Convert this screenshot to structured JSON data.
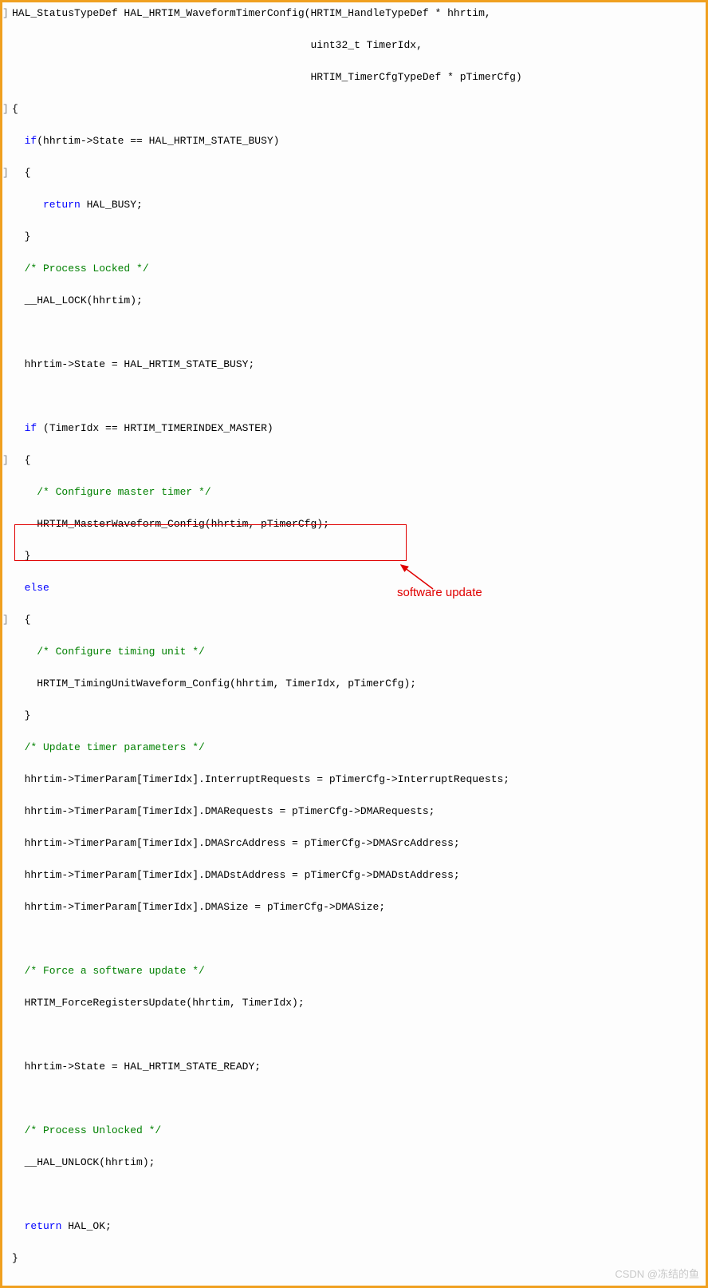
{
  "code": {
    "l1a": "HAL_StatusTypeDef HAL_HRTIM_WaveformTimerConfig(HRTIM_HandleTypeDef * hhrtim,",
    "l1b": "                                                uint32_t TimerIdx,",
    "l1c": "                                                HRTIM_TimerCfgTypeDef * pTimerCfg)",
    "l2": "{",
    "l3a": "  if",
    "l3b": "(hhrtim->State == HAL_HRTIM_STATE_BUSY)",
    "l4": "  {",
    "l5a": "     return",
    "l5b": " HAL_BUSY;",
    "l6": "  }",
    "l7": "  /* Process Locked */",
    "l8": "  __HAL_LOCK(hhrtim);",
    "l9": "",
    "l10": "  hhrtim->State = HAL_HRTIM_STATE_BUSY;",
    "l11": "",
    "l12a": "  if",
    "l12b": " (TimerIdx == HRTIM_TIMERINDEX_MASTER)",
    "l13": "  {",
    "l14": "    /* Configure master timer */",
    "l15": "    HRTIM_MasterWaveform_Config(hhrtim, pTimerCfg);",
    "l16": "  }",
    "l17": "  else",
    "l18": "  {",
    "l19": "    /* Configure timing unit */",
    "l20": "    HRTIM_TimingUnitWaveform_Config(hhrtim, TimerIdx, pTimerCfg);",
    "l21": "  }",
    "l22": "  /* Update timer parameters */",
    "l23": "  hhrtim->TimerParam[TimerIdx].InterruptRequests = pTimerCfg->InterruptRequests;",
    "l24": "  hhrtim->TimerParam[TimerIdx].DMARequests = pTimerCfg->DMARequests;",
    "l25": "  hhrtim->TimerParam[TimerIdx].DMASrcAddress = pTimerCfg->DMASrcAddress;",
    "l26": "  hhrtim->TimerParam[TimerIdx].DMADstAddress = pTimerCfg->DMADstAddress;",
    "l27": "  hhrtim->TimerParam[TimerIdx].DMASize = pTimerCfg->DMASize;",
    "l28": "",
    "l29": "  /* Force a software update */",
    "l30": "  HRTIM_ForceRegistersUpdate(hhrtim, TimerIdx);",
    "l31": "",
    "l32": "  hhrtim->State = HAL_HRTIM_STATE_READY;",
    "l33": "",
    "l34": "  /* Process Unlocked */",
    "l35": "  __HAL_UNLOCK(hhrtim);",
    "l36": "",
    "l37a": "  return",
    "l37b": " HAL_OK;",
    "l38": "}"
  },
  "fold": {
    "close": "]",
    "open": "]"
  },
  "annotation": "software update",
  "watermark": "CSDN @冻结的鱼"
}
